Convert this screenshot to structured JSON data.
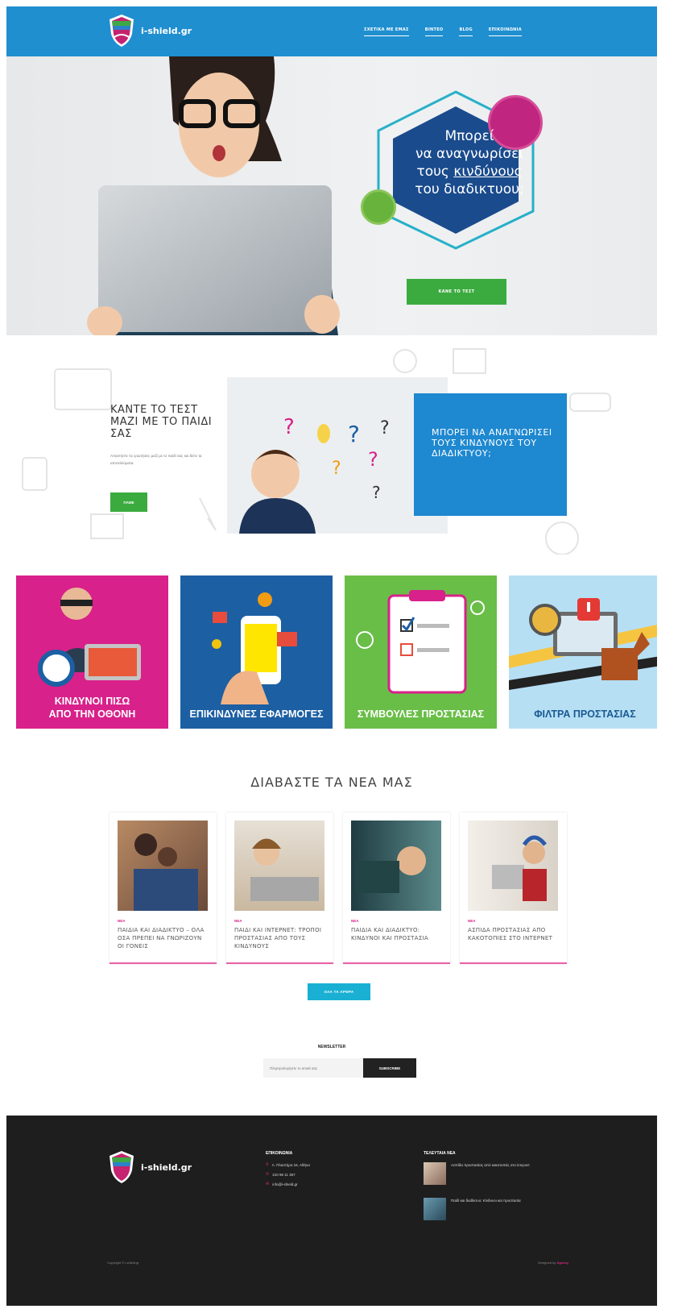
{
  "header": {
    "logo_text": "i-shield.gr",
    "nav": [
      "ΣΧΕΤΙΚΑ ΜΕ ΕΜΑΣ",
      "ΒΙΝΤΕΟ",
      "BLOG",
      "ΕΠΙΚΟΙΝΩΝΙΑ"
    ]
  },
  "hero": {
    "line1": "Μπορεί",
    "line2": "να αναγνωρίσει",
    "line3a": "τους ",
    "line3b": "κινδύνους",
    "line4": "του διαδικτυου;",
    "button": "ΚΑΝΕ ΤΟ ΤΕΣΤ"
  },
  "test": {
    "title": "ΚΑΝΤΕ ΤΟ ΤΕΣΤ ΜΑΖΙ ΜΕ ΤΟ ΠΑΙΔΙ ΣΑΣ",
    "description": "Απαντήστε τις ερωτήσεις μαζί με το παιδί σας και δείτε τα αποτελέσματα.",
    "button": "ΠΑΜΕ",
    "box": "ΜΠΟΡΕΙ ΝΑ ΑΝΑΓΝΩΡΙΣΕΙ ΤΟΥΣ ΚΙΝΔΥΝΟΥΣ ΤΟΥ ΔΙΑΔΙΚΤΥΟΥ;"
  },
  "tiles": [
    {
      "l1": "ΚΙΝΔΥΝΟΙ ΠΙΣΩ",
      "l2": "ΑΠΟ ΤΗΝ ΟΘΟΝΗ",
      "color": "#d8218a"
    },
    {
      "l1": "ΕΠΙΚΙΝΔΥΝΕΣ ΕΦΑΡΜΟΓΕΣ",
      "l2": "",
      "color": "#1c5fa3"
    },
    {
      "l1": "ΣΥΜΒΟΥΛΕΣ ΠΡΟΣΤΑΣΙΑΣ",
      "l2": "",
      "color": "#69be47"
    },
    {
      "l1": "ΦΙΛΤΡΑ ΠΡΟΣΤΑΣΙΑΣ",
      "l2": "",
      "color": "#b6dff4"
    }
  ],
  "news": {
    "title": "ΔΙΑΒΑΣΤΕ ΤΑ ΝΕΑ ΜΑΣ",
    "cards": [
      {
        "tag": "ΝΕΑ",
        "title": "ΠΑΙΔΙΑ ΚΑΙ ΔΙΑΔΙΚΤΥΟ – ΟΛΑ ΟΣΑ ΠΡΕΠΕΙ ΝΑ ΓΝΩΡΙΖΟΥΝ ΟΙ ΓΟΝΕΙΣ"
      },
      {
        "tag": "ΝΕΑ",
        "title": "ΠΑΙΔΙ ΚΑΙ ΙΝΤΕΡΝΕΤ: ΤΡΟΠΟΙ ΠΡΟΣΤΑΣΙΑΣ ΑΠΟ ΤΟΥΣ ΚΙΝΔΥΝΟΥΣ"
      },
      {
        "tag": "ΝΕΑ",
        "title": "ΠΑΙΔΙΑ ΚΑΙ ΔΙΑΔΙΚΤΥΟ: ΚΙΝΔΥΝΟΙ ΚΑΙ ΠΡΟΣΤΑΣΙΑ"
      },
      {
        "tag": "ΝΕΑ",
        "title": "ΑΣΠΙΔΑ ΠΡΟΣΤΑΣΙΑΣ ΑΠΟ ΚΑΚΟΤΟΠΙΕΣ ΣΤΟ ΙΝΤΕΡΝΕΤ"
      }
    ],
    "all_button": "ΟΛΑ ΤΑ ΑΡΘΡΑ"
  },
  "newsletter": {
    "label": "NEWSLETTER",
    "placeholder": "Πληκτρολογήστε το email σας",
    "button": "SUBSCRIBE"
  },
  "footer": {
    "logo_text": "i-shield.gr",
    "contact_head": "ΕΠΙΚΟΙΝΩΝΙΑ",
    "address": "Λ. Πλαστήρα 16, Αθήνα",
    "phone": "210 96 11 367",
    "email": "info@i-shield.gr",
    "posts_head": "ΤΕΛΕΥΤΑΙΑ ΝΕΑ",
    "post1": "Ασπίδα προστασίας από κακοτοπιές στο ίντερνετ",
    "post2": "Παιδί και διαδίκτυο: Κίνδυνοι και προστασία",
    "copyright": "Copyright © i-shield.gr",
    "credit_pre": "Designed by",
    "credit_name": "Agency"
  }
}
